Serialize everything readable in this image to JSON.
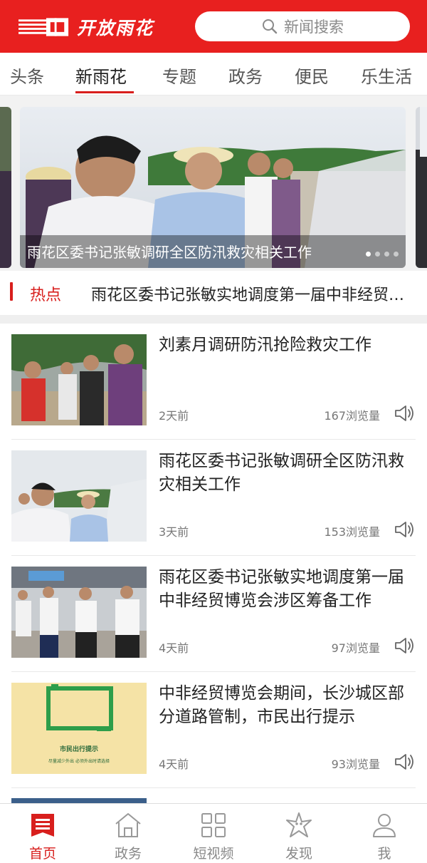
{
  "header": {
    "logo_text": "开放雨花",
    "search_placeholder": "新闻搜索"
  },
  "tabs": [
    {
      "label": "头条",
      "active": false
    },
    {
      "label": "新雨花",
      "active": true
    },
    {
      "label": "专题",
      "active": false
    },
    {
      "label": "政务",
      "active": false
    },
    {
      "label": "便民",
      "active": false
    },
    {
      "label": "乐生活",
      "active": false
    }
  ],
  "carousel": {
    "caption": "雨花区委书记张敏调研全区防汛救灾相关工作",
    "slide_count": 4,
    "active_index": 0
  },
  "hot": {
    "label": "热点",
    "text": "雨花区委书记张敏实地调度第一届中非经贸博览会涉区筹备工作"
  },
  "news": [
    {
      "title": "刘素月调研防汛抢险救灾工作",
      "time": "2天前",
      "views": "167浏览量"
    },
    {
      "title": "雨花区委书记张敏调研全区防汛救灾相关工作",
      "time": "3天前",
      "views": "153浏览量"
    },
    {
      "title": "雨花区委书记张敏实地调度第一届中非经贸博览会涉区筹备工作",
      "time": "4天前",
      "views": "97浏览量"
    },
    {
      "title": "中非经贸博览会期间，长沙城区部分道路管制，市民出行提示",
      "time": "4天前",
      "views": "93浏览量"
    }
  ],
  "map_thumb": {
    "tip_title": "市民出行提示",
    "tip_sub": "尽量减少外出  必须外出时请选择"
  },
  "bottom_nav": [
    {
      "label": "首页",
      "icon": "news-home-icon",
      "active": true
    },
    {
      "label": "政务",
      "icon": "government-house-icon",
      "active": false
    },
    {
      "label": "短视频",
      "icon": "grid-icon",
      "active": false
    },
    {
      "label": "发现",
      "icon": "starfish-discover-icon",
      "active": false
    },
    {
      "label": "我",
      "icon": "user-icon",
      "active": false
    }
  ],
  "colors": {
    "brand_red": "#e8201f",
    "accent_red": "#d81f1d"
  }
}
